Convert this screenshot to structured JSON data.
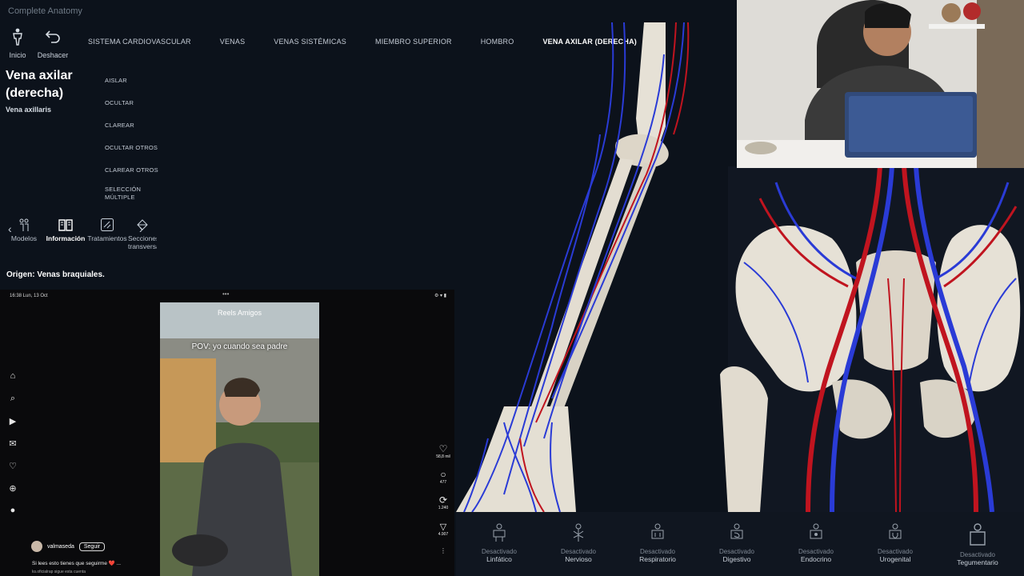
{
  "app": {
    "title": "Complete Anatomy"
  },
  "toolbar": {
    "home_label": "Inicio",
    "undo_label": "Deshacer"
  },
  "breadcrumb": [
    "SISTEMA CARDIOVASCULAR",
    "VENAS",
    "VENAS SISTÉMICAS",
    "MIEMBRO SUPERIOR",
    "HOMBRO",
    "VENA AXILAR (DERECHA)"
  ],
  "structure": {
    "name": "Vena axilar (derecha)",
    "latin": "Vena axillaris",
    "origin": "Origen: Venas braquiales."
  },
  "actions": [
    "AISLAR",
    "OCULTAR",
    "CLAREAR",
    "OCULTAR OTROS",
    "CLAREAR OTROS",
    "SELECCIÓN MÚLTIPLE"
  ],
  "tabs": [
    {
      "label": "Modelos",
      "icon": "models-icon"
    },
    {
      "label": "Información",
      "icon": "book-icon"
    },
    {
      "label": "Tratamientos",
      "icon": "treatment-icon"
    },
    {
      "label": "Secciones transversales",
      "icon": "cross-section-icon"
    }
  ],
  "phone": {
    "status_left": "16:38  Lun, 13 Oct",
    "tabs": "Reels     Amigos",
    "caption": "POV: yo cuando sea padre",
    "counts": {
      "likes": "58,8 mil",
      "comments": "477",
      "reposts": "1.240",
      "shares": "4.907"
    },
    "username": "valmaseda",
    "follow_label": "Seguir",
    "description": "Si lees esto tienes que seguirme ❤️ ...",
    "description2": "ks.oficialrap sigue esta cuenta"
  },
  "systems": [
    {
      "state": "Desactivado",
      "name": "Linfático",
      "icon": "lymphatic-icon"
    },
    {
      "state": "Desactivado",
      "name": "Nervioso",
      "icon": "nervous-icon"
    },
    {
      "state": "Desactivado",
      "name": "Respiratorio",
      "icon": "respiratory-icon"
    },
    {
      "state": "Desactivado",
      "name": "Digestivo",
      "icon": "digestive-icon"
    },
    {
      "state": "Desactivado",
      "name": "Endocrino",
      "icon": "endocrine-icon"
    },
    {
      "state": "Desactivado",
      "name": "Urogenital",
      "icon": "urogenital-icon"
    },
    {
      "state": "Desactivado",
      "name": "Tegumentario",
      "icon": "integumentary-icon"
    }
  ],
  "colors": {
    "vein": "#2a3bd6",
    "artery": "#c0141f",
    "bone": "#e6e1d6",
    "background": "#0c121b"
  }
}
